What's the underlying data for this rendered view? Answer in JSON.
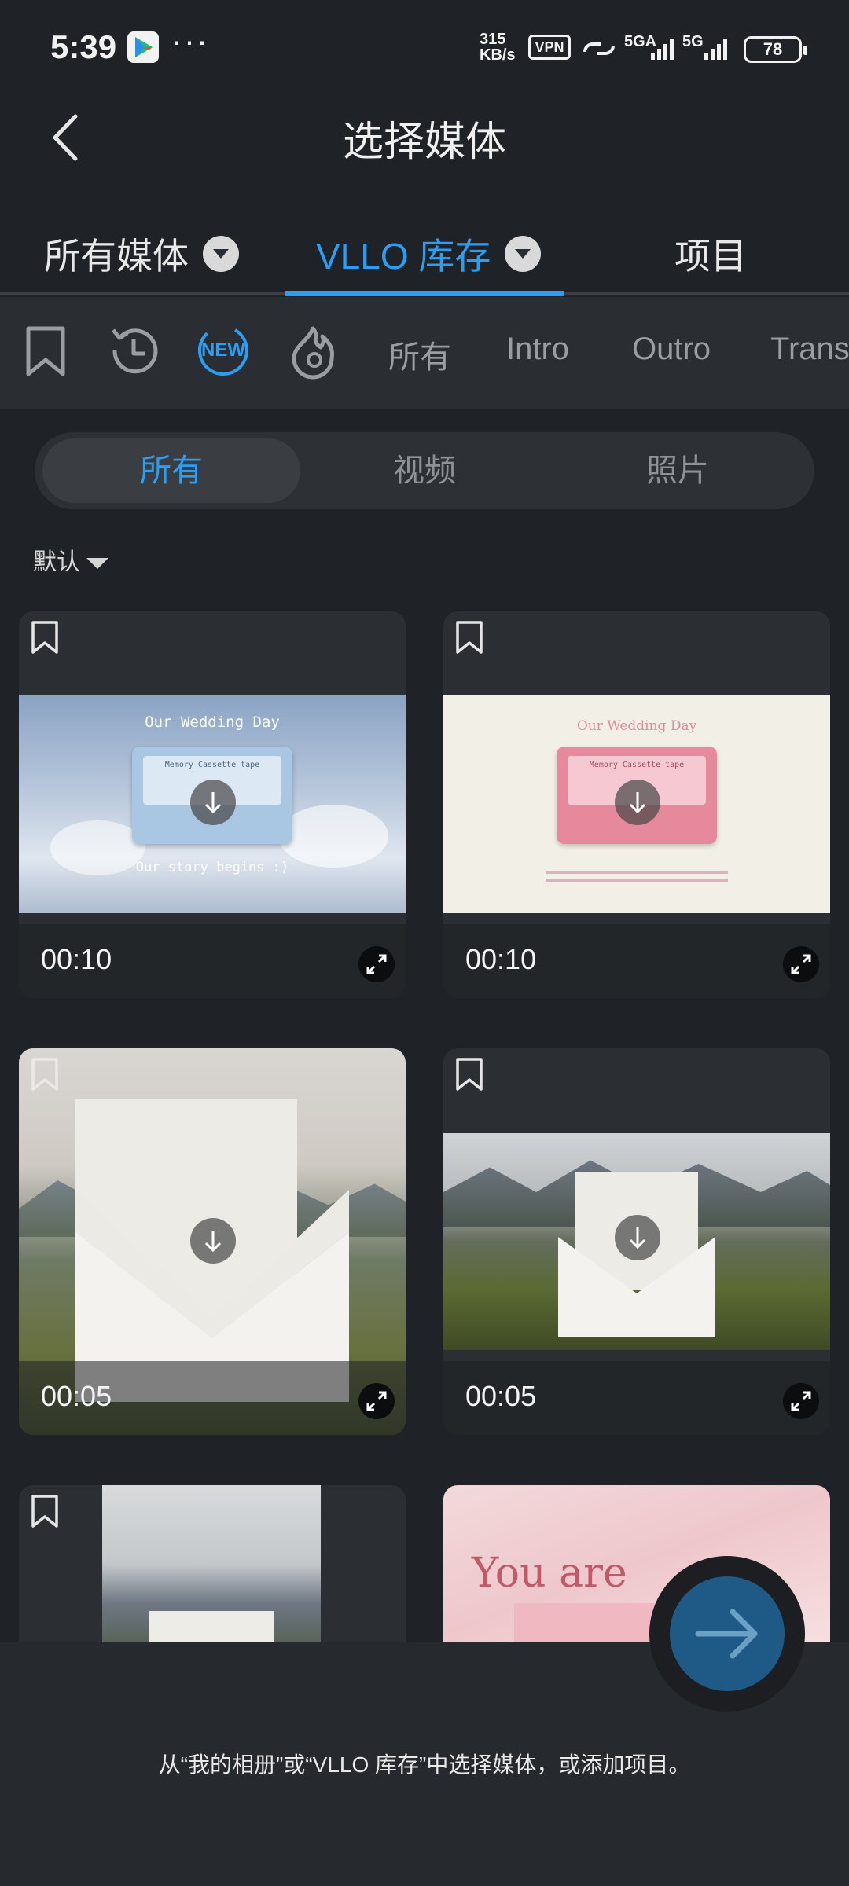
{
  "status": {
    "time": "5:39",
    "speed_value": "315",
    "speed_unit": "KB/s",
    "vpn": "VPN",
    "net1": "5GA",
    "net2": "5G",
    "battery": "78"
  },
  "header": {
    "title": "选择媒体"
  },
  "source_tabs": [
    {
      "label": "所有媒体"
    },
    {
      "label": "VLLO 库存"
    },
    {
      "label": "项目"
    }
  ],
  "categories": {
    "new_badge": "NEW",
    "items": [
      "所有",
      "Intro",
      "Outro",
      "Trans"
    ]
  },
  "segment": [
    "所有",
    "视频",
    "照片"
  ],
  "sort": {
    "label": "默认"
  },
  "media": [
    {
      "duration": "00:10",
      "title": "Our Wedding Day",
      "subtitle": "Our story begins :)",
      "tape": "Memory Cassette tape"
    },
    {
      "duration": "00:10",
      "title": "Our Wedding Day",
      "tape": "Memory Cassette tape"
    },
    {
      "duration": "00:05"
    },
    {
      "duration": "00:05"
    },
    {},
    {
      "caption": "You are"
    }
  ],
  "bottom": {
    "hint": "从“我的相册”或“VLLO 库存”中选择媒体，或添加项目。"
  },
  "colors": {
    "accent": "#2a9df4",
    "background": "#1f2226",
    "fab": "#1f5a87"
  }
}
